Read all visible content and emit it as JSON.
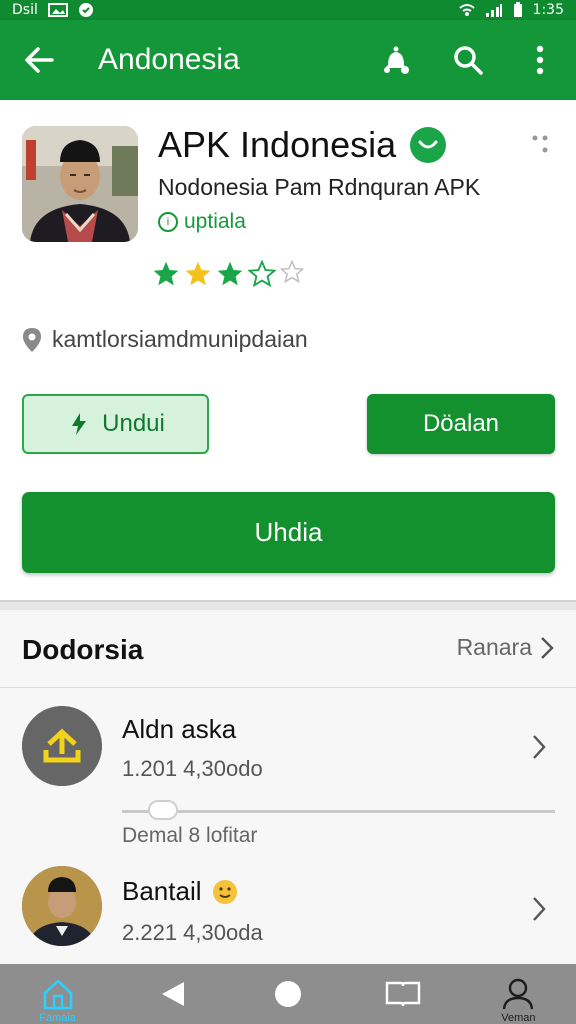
{
  "status_bar": {
    "left_text": "Dsil",
    "right_text": "1:35"
  },
  "app_bar": {
    "title": "Andonesia"
  },
  "app": {
    "name": "APK Indonesia",
    "subtitle": "Nodonesia Pam Rdnquran APK",
    "update_tag": "uptiala",
    "rating_stars": 3,
    "rating_max": 5,
    "location": "kamtlorsiamdmunipdaian"
  },
  "buttons": {
    "outline_label": "Undui",
    "solid_label": "Döalan",
    "wide_label": "Uhdia"
  },
  "section": {
    "title": "Dodorsia",
    "see_more": "Ranara",
    "items": [
      {
        "title": "Aldn aska",
        "sub": "1.201 4,30odo",
        "progress": 0.05,
        "progress_label": "Demal 8 lofitar"
      },
      {
        "title": "Bantail",
        "sub": "2.221 4,30oda"
      }
    ]
  },
  "bottom_nav": {
    "items": [
      {
        "label": "Famaia",
        "icon": "home-icon"
      },
      {
        "label": "",
        "icon": "back-triangle-icon"
      },
      {
        "label": "",
        "icon": "home-circle-icon"
      },
      {
        "label": "",
        "icon": "book-icon"
      },
      {
        "label": "Veman",
        "icon": "profile-icon"
      }
    ]
  },
  "colors": {
    "brand_green": "#149738",
    "status_green": "#0f8a30",
    "star_green": "#1aa548",
    "star_yellow": "#f4c21c",
    "nav_bg": "#8e8e8e",
    "nav_active": "#2bd0ff"
  }
}
